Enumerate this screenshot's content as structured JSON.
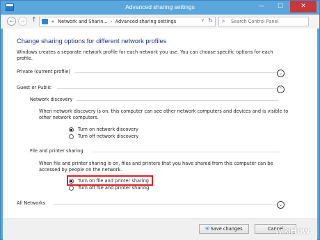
{
  "window": {
    "title": "Advanced sharing settings",
    "controls": {
      "minimize": "—",
      "maximize": "☐",
      "close": "✕"
    }
  },
  "nav": {
    "back": "←",
    "forward": "→",
    "up": "↑",
    "breadcrumb": [
      "Network and Sharin...",
      "Advanced sharing settings"
    ],
    "breadcrumb_prefix": "«",
    "separator": "›",
    "dropdown": "v",
    "refresh": "↻",
    "search_placeholder": "Search Control Panel"
  },
  "main": {
    "heading": "Change sharing options for different network profiles",
    "description": "Windows creates a separate network profile for each network you use. You can choose specific options for each profile.",
    "profiles": [
      {
        "label": "Private (current profile)",
        "state": "collapsed"
      },
      {
        "label": "Guest or Public",
        "state": "expanded"
      },
      {
        "label": "All Networks",
        "state": "collapsed"
      }
    ],
    "network_discovery": {
      "title": "Network discovery",
      "text": "When network discovery is on, this computer can see other network computers and devices and is visible to other network computers.",
      "options": [
        {
          "label": "Turn on network discovery",
          "selected": true
        },
        {
          "label": "Turn off network discovery",
          "selected": false
        }
      ]
    },
    "file_sharing": {
      "title": "File and printer sharing",
      "text": "When file and printer sharing is on, files and printers that you have shared from this computer can be accessed by people on the network.",
      "options": [
        {
          "label": "Turn on file and printer sharing",
          "selected": true
        },
        {
          "label": "Turn off file and printer sharing",
          "selected": false
        }
      ]
    },
    "chevron_down": "⌄",
    "chevron_up": "⌃"
  },
  "footer": {
    "save_label": "Save changes",
    "cancel_label": "Cancel"
  },
  "watermark": {
    "prefix": "wiki",
    "suffix": "How"
  },
  "colors": {
    "titlebar": "#5ba7dc",
    "heading": "#1e3287",
    "highlight": "#e31b23",
    "close_button": "#c7383a"
  }
}
